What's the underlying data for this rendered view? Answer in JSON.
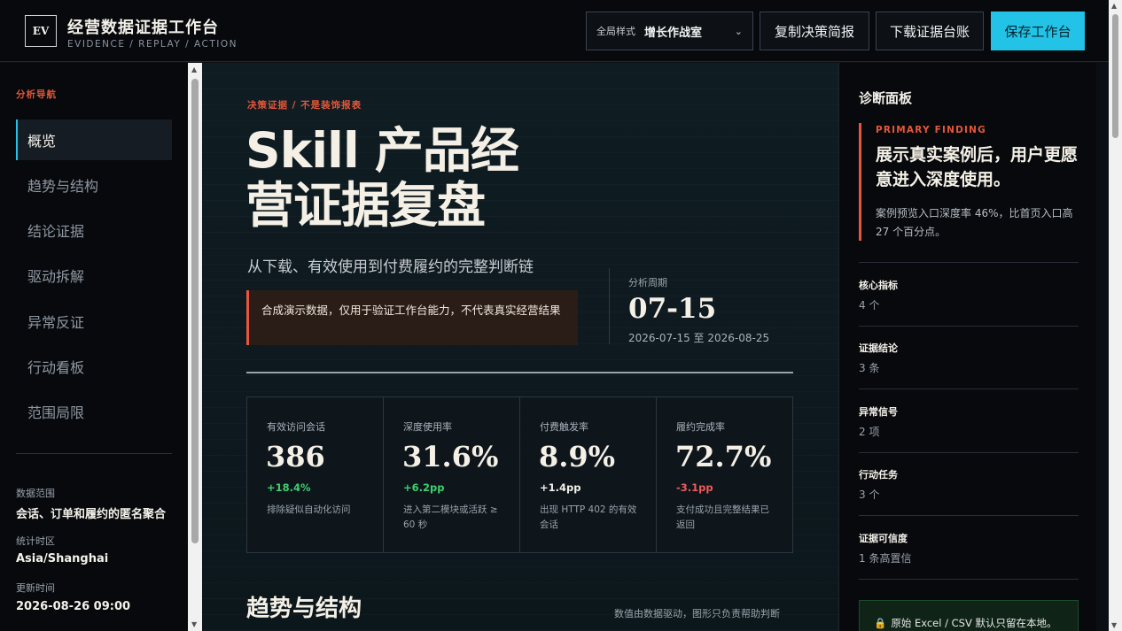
{
  "app": {
    "logo": "EV",
    "title": "经营数据证据工作台",
    "subtitle": "EVIDENCE / REPLAY / ACTION"
  },
  "toolbar": {
    "style_label": "全局样式",
    "style_value": "增长作战室",
    "copy_label": "复制决策简报",
    "download_label": "下载证据台账",
    "save_label": "保存工作台"
  },
  "sidebar": {
    "heading": "分析导航",
    "items": [
      {
        "label": "概览",
        "active": true
      },
      {
        "label": "趋势与结构",
        "active": false
      },
      {
        "label": "结论证据",
        "active": false
      },
      {
        "label": "驱动拆解",
        "active": false
      },
      {
        "label": "异常反证",
        "active": false
      },
      {
        "label": "行动看板",
        "active": false
      },
      {
        "label": "范围局限",
        "active": false
      }
    ],
    "meta": [
      {
        "label": "数据范围",
        "value": "会话、订单和履约的匿名聚合"
      },
      {
        "label": "统计时区",
        "value": "Asia/Shanghai"
      },
      {
        "label": "更新时间",
        "value": "2026-08-26 09:00"
      }
    ]
  },
  "hero": {
    "eyebrow": "决策证据 / 不是装饰报表",
    "title": "Skill 产品经营证据复盘",
    "subtitle": "从下载、有效使用到付费履约的完整判断链",
    "notice": "合成演示数据，仅用于验证工作台能力，不代表真实经营结果",
    "period_label": "分析周期",
    "period_value": "07-15",
    "period_range": "2026-07-15 至 2026-08-25"
  },
  "kpis": [
    {
      "label": "有效访问会话",
      "value": "386",
      "delta": "+18.4%",
      "delta_color": "#3ecf6e",
      "note": "排除疑似自动化访问"
    },
    {
      "label": "深度使用率",
      "value": "31.6%",
      "delta": "+6.2pp",
      "delta_color": "#3ecf6e",
      "note": "进入第二模块或活跃 ≥ 60 秒"
    },
    {
      "label": "付费触发率",
      "value": "8.9%",
      "delta": "+1.4pp",
      "delta_color": "#f4f1ea",
      "note": "出现 HTTP 402 的有效会话"
    },
    {
      "label": "履约完成率",
      "value": "72.7%",
      "delta": "-3.1pp",
      "delta_color": "#ef5a5a",
      "note": "支付成功且完整结果已返回"
    }
  ],
  "section": {
    "title": "趋势与结构",
    "note": "数值由数据驱动，图形只负责帮助判断"
  },
  "panel": {
    "title": "诊断面板",
    "finding_tag": "PRIMARY FINDING",
    "finding_head": "展示真实案例后，用户更愿意进入深度使用。",
    "finding_desc": "案例预览入口深度率 46%，比首页入口高 27 个百分点。",
    "stats": [
      {
        "label": "核心指标",
        "value": "4 个"
      },
      {
        "label": "证据结论",
        "value": "3 条"
      },
      {
        "label": "异常信号",
        "value": "2 项"
      },
      {
        "label": "行动任务",
        "value": "3 个"
      },
      {
        "label": "证据可信度",
        "value": "1 条高置信"
      }
    ],
    "local_note": "原始 Excel / CSV 默认只留在本地。"
  },
  "colors": {
    "accent": "#22c3e6",
    "warning": "#e5573a",
    "positive": "#3ecf6e",
    "negative": "#ef5a5a"
  }
}
